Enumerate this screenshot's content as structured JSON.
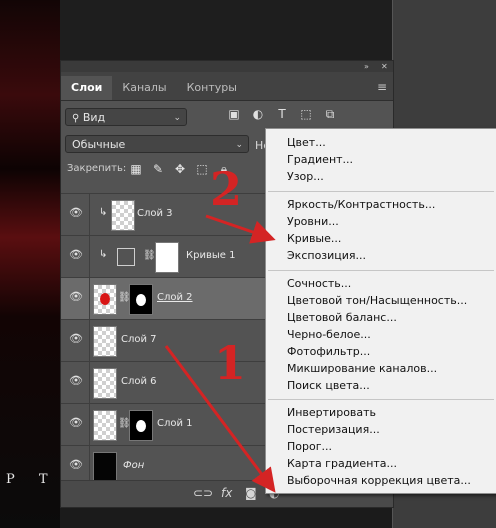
{
  "canvas": {
    "text": "P T E"
  },
  "panel": {
    "tabs": [
      {
        "label": "Слои",
        "active": true
      },
      {
        "label": "Каналы",
        "active": false
      },
      {
        "label": "Контуры",
        "active": false
      }
    ],
    "filter": {
      "value": "Вид"
    },
    "blend": {
      "value": "Обычные"
    },
    "opacity_label_cut": "Не",
    "lock_label": "Закрепить:"
  },
  "layers": [
    {
      "name": "Слой 3"
    },
    {
      "name": "Кривые 1"
    },
    {
      "name": "Слой 2"
    },
    {
      "name": "Слой 7"
    },
    {
      "name": "Слой 6"
    },
    {
      "name": "Слой 1"
    },
    {
      "name": "Фон"
    }
  ],
  "bottombar": {
    "fx": "fx"
  },
  "menu": {
    "items": [
      "Цвет...",
      "Градиент...",
      "Узор...",
      "Яркость/Контрастность...",
      "Уровни...",
      "Кривые...",
      "Экспозиция...",
      "Сочность...",
      "Цветовой тон/Насыщенность...",
      "Цветовой баланс...",
      "Черно-белое...",
      "Фотофильтр...",
      "Микширование каналов...",
      "Поиск цвета...",
      "Инвертировать",
      "Постеризация...",
      "Порог...",
      "Карта градиента...",
      "Выборочная коррекция цвета..."
    ]
  },
  "annotations": {
    "one": "1",
    "two": "2",
    "color": "#d42424"
  }
}
